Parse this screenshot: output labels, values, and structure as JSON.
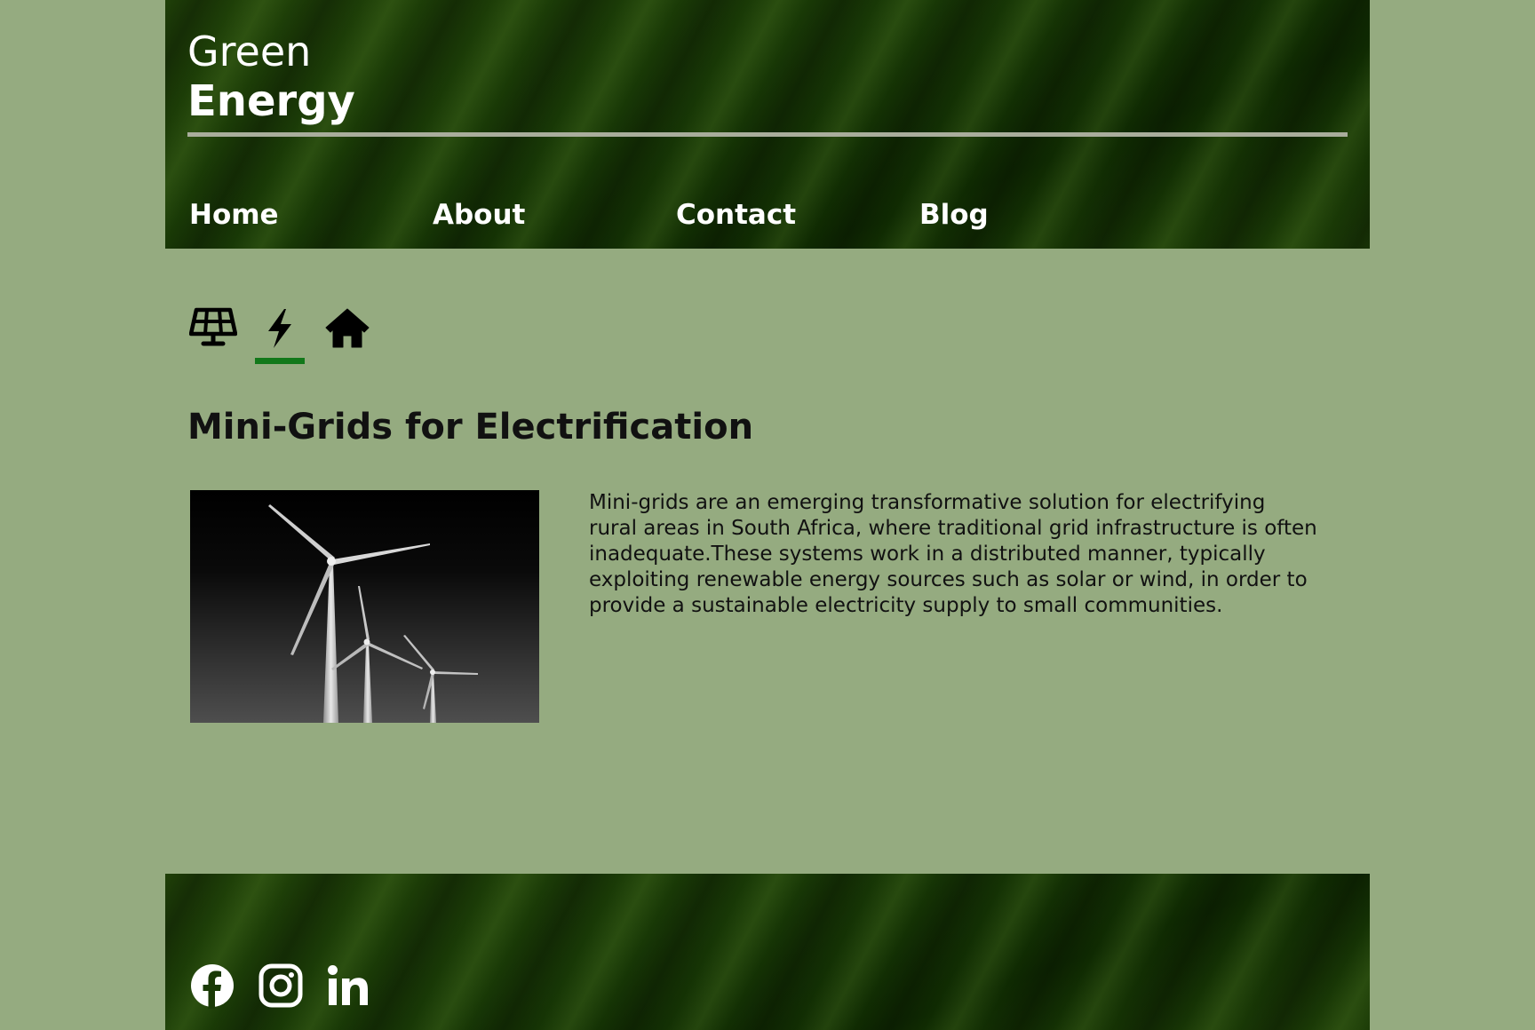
{
  "brand": {
    "line1": "Green",
    "line2": "Energy"
  },
  "nav": {
    "items": [
      {
        "label": "Home"
      },
      {
        "label": "About"
      },
      {
        "label": "Contact"
      },
      {
        "label": "Blog"
      }
    ]
  },
  "tabs": [
    {
      "icon": "solar-panel-icon",
      "active": false
    },
    {
      "icon": "bolt-icon",
      "active": true
    },
    {
      "icon": "house-icon",
      "active": false
    }
  ],
  "article": {
    "title": "Mini-Grids for Electrification",
    "image_icon": "wind-turbines-photo",
    "body": "Mini-grids are an emerging transformative solution for electrifying rural areas in South Africa, where traditional grid infrastructure is often inadequate.These systems work in a distributed manner, typically exploiting renewable energy sources such as solar or wind, in order to provide a sustainable electricity supply to small communities."
  },
  "footer": {
    "social": [
      {
        "icon": "facebook-icon"
      },
      {
        "icon": "instagram-icon"
      },
      {
        "icon": "linkedin-icon"
      }
    ]
  },
  "colors": {
    "page_background": "#95ab80",
    "header_green": "#1a3a06",
    "active_tab_underline": "#12781a",
    "text_dark": "#111111",
    "text_light": "#ffffff"
  }
}
